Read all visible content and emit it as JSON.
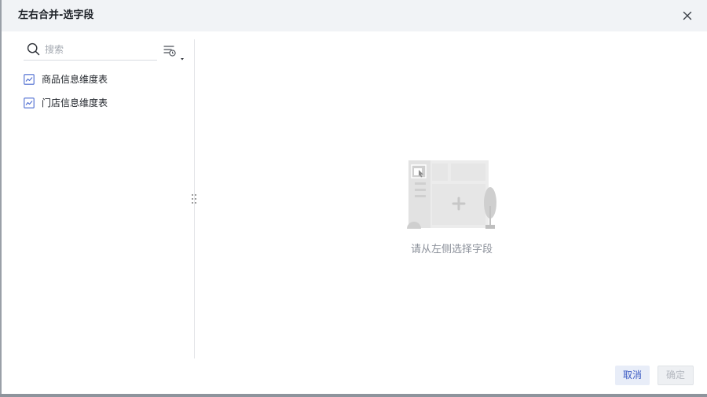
{
  "dialog": {
    "title": "左右合并-选字段",
    "close_icon": "close-icon"
  },
  "search": {
    "placeholder": "搜索",
    "value": ""
  },
  "tables": [
    {
      "label": "商品信息维度表",
      "icon": "table-chart-icon"
    },
    {
      "label": "门店信息维度表",
      "icon": "table-chart-icon"
    }
  ],
  "empty_state": {
    "text": "请从左侧选择字段"
  },
  "footer": {
    "cancel_label": "取消",
    "ok_label": "确定"
  },
  "colors": {
    "header_bg": "#f1f3f6",
    "accent": "#3d5cc4",
    "icon_blue": "#4a6ad0",
    "text": "#1f2329",
    "muted": "#8a8f99"
  }
}
